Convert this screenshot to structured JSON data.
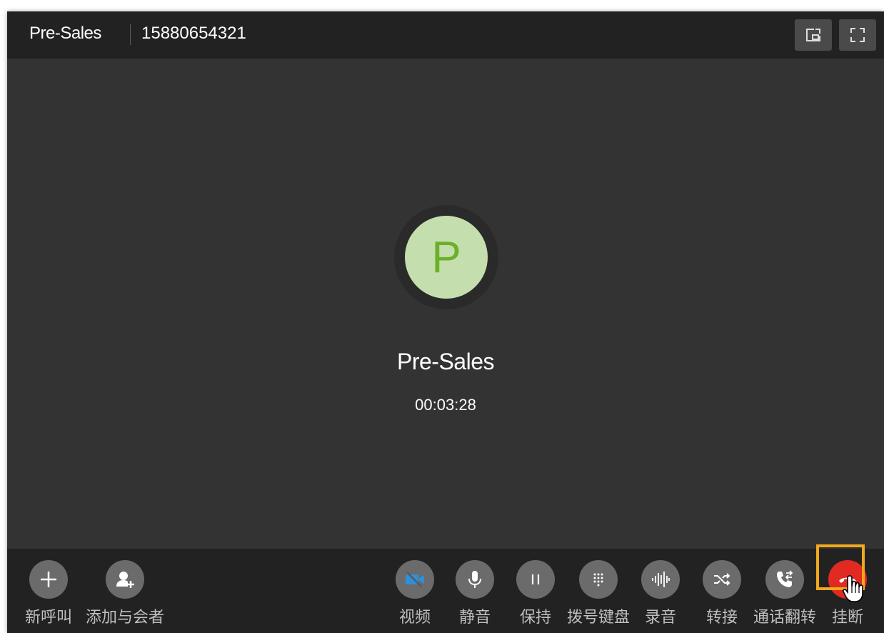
{
  "header": {
    "name": "Pre-Sales",
    "number": "15880654321",
    "pip_icon": "picture-in-picture-icon",
    "fullscreen_icon": "fullscreen-icon"
  },
  "caller": {
    "initial": "P",
    "name": "Pre-Sales",
    "duration": "00:03:28"
  },
  "toolbar": {
    "new_call": {
      "label": "新呼叫",
      "icon": "plus-icon"
    },
    "add_participant": {
      "label": "添加与会者",
      "icon": "add-user-icon"
    },
    "video": {
      "label": "视频",
      "icon": "video-off-icon"
    },
    "mute": {
      "label": "静音",
      "icon": "microphone-icon"
    },
    "hold": {
      "label": "保持",
      "icon": "pause-icon"
    },
    "dialpad": {
      "label": "拨号键盘",
      "icon": "dialpad-icon"
    },
    "record": {
      "label": "录音",
      "icon": "waveform-icon"
    },
    "transfer": {
      "label": "转接",
      "icon": "shuffle-icon"
    },
    "flip": {
      "label": "通话翻转",
      "icon": "call-flip-icon"
    },
    "hangup": {
      "label": "挂断",
      "icon": "hang-up-icon"
    }
  },
  "colors": {
    "background": "#333333",
    "bar": "#222222",
    "avatar_bg": "#c5deae",
    "avatar_text": "#6ab029",
    "hangup": "#e02a22",
    "video_accent": "#2f8fd8",
    "highlight": "#f0a81c"
  }
}
